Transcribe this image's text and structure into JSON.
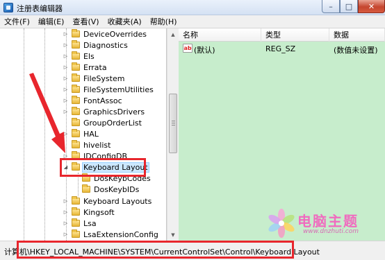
{
  "window": {
    "title": "注册表编辑器",
    "controls": {
      "minimize_glyph": "–",
      "maximize_glyph": "□",
      "close_glyph": "✕"
    }
  },
  "menu": [
    "文件(F)",
    "编辑(E)",
    "查看(V)",
    "收藏夹(A)",
    "帮助(H)"
  ],
  "tree": {
    "items": [
      {
        "label": "DeviceOverrides",
        "expander": "▷"
      },
      {
        "label": "Diagnostics",
        "expander": "▷"
      },
      {
        "label": "Els",
        "expander": "▷"
      },
      {
        "label": "Errata",
        "expander": "▷"
      },
      {
        "label": "FileSystem",
        "expander": "▷"
      },
      {
        "label": "FileSystemUtilities",
        "expander": "▷"
      },
      {
        "label": "FontAssoc",
        "expander": "▷"
      },
      {
        "label": "GraphicsDrivers",
        "expander": "▷"
      },
      {
        "label": "GroupOrderList",
        "expander": ""
      },
      {
        "label": "HAL",
        "expander": "▷"
      },
      {
        "label": "hivelist",
        "expander": ""
      },
      {
        "label": "IDConfigDB",
        "expander": "▷"
      },
      {
        "label": "Keyboard Layout",
        "expander": "◢",
        "selected": true
      },
      {
        "label": "DosKeybCodes",
        "expander": "",
        "child": true
      },
      {
        "label": "DosKeybIDs",
        "expander": "",
        "child": true
      },
      {
        "label": "Keyboard Layouts",
        "expander": "▷"
      },
      {
        "label": "Kingsoft",
        "expander": "▷"
      },
      {
        "label": "Lsa",
        "expander": "▷"
      },
      {
        "label": "LsaExtensionConfig",
        "expander": "▷"
      }
    ]
  },
  "scrollbar": {
    "up_glyph": "▲",
    "down_glyph": "▼"
  },
  "values": {
    "columns": [
      "名称",
      "类型",
      "数据"
    ],
    "rows": [
      {
        "icon": "ab",
        "name": "(默认)",
        "type": "REG_SZ",
        "data": "(数值未设置)"
      }
    ]
  },
  "statusbar": {
    "path": "计算机\\HKEY_LOCAL_MACHINE\\SYSTEM\\CurrentControlSet\\Control\\Keyboard Layout"
  },
  "watermark": {
    "title": "电脑主题",
    "url": "www.dnzhuti.com"
  },
  "colors": {
    "right_pane_bg": "#c7edcc",
    "highlight_red": "#e8262d",
    "selection_bg": "#cce8ff",
    "watermark_pink": "#f06bbf"
  }
}
